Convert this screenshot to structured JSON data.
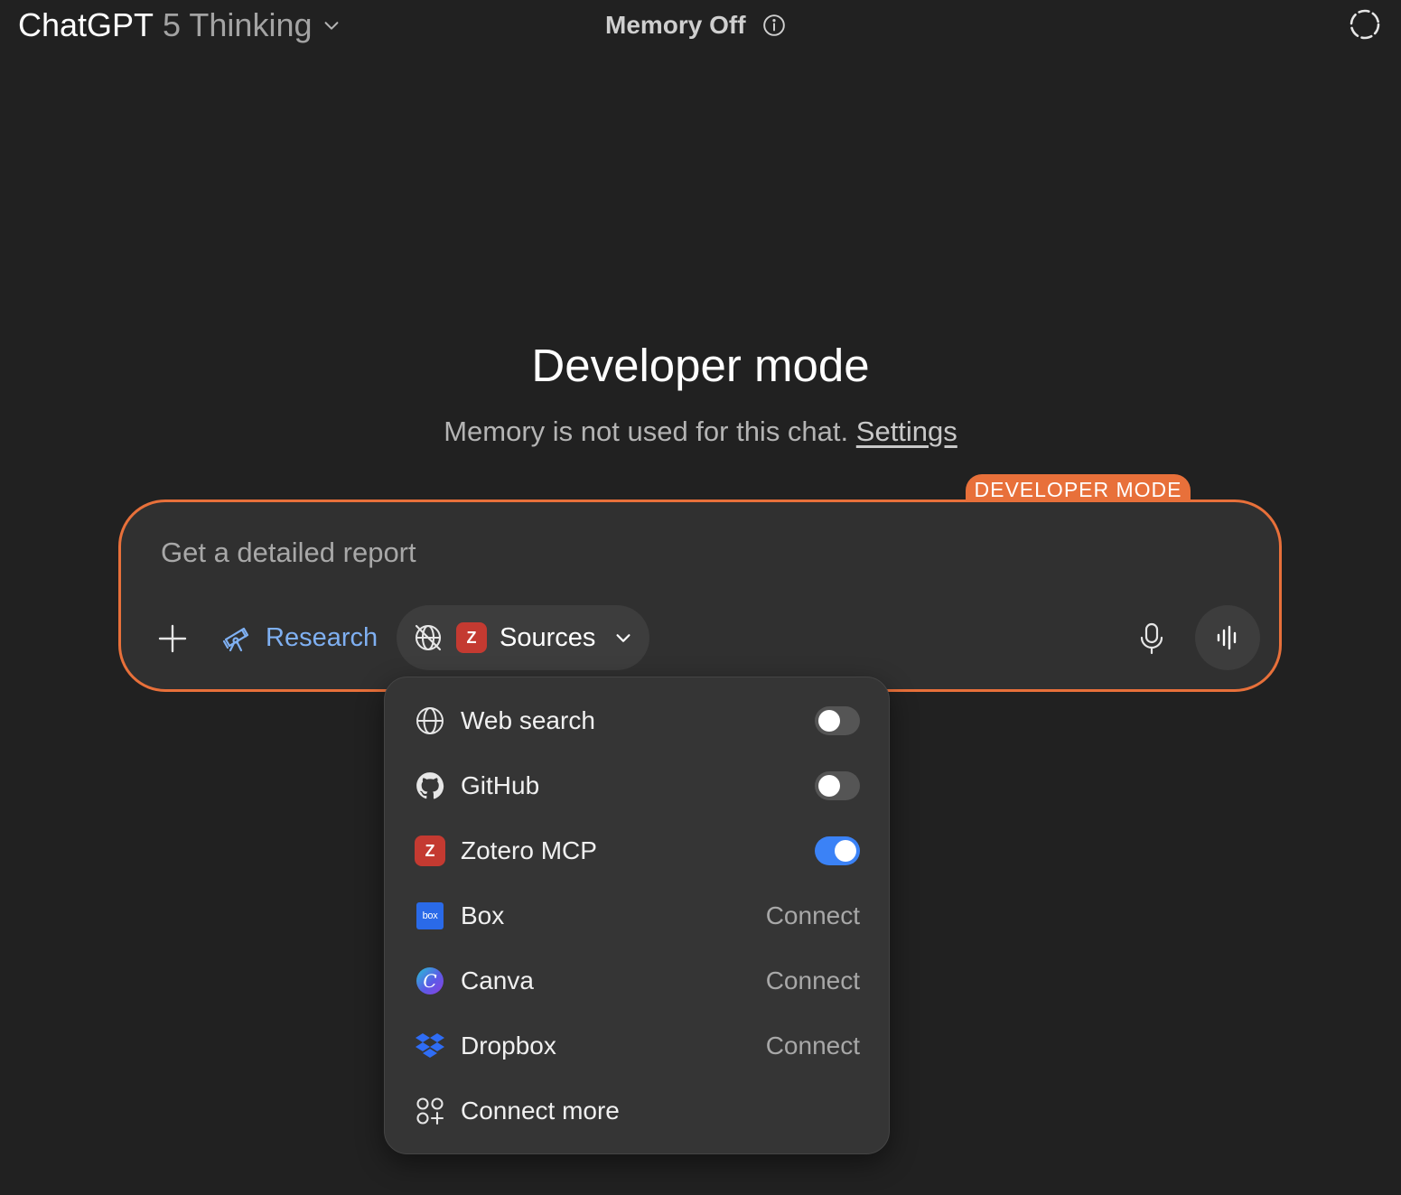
{
  "header": {
    "model_name": "ChatGPT",
    "model_variant": "5 Thinking",
    "memory_status": "Memory Off"
  },
  "hero": {
    "title": "Developer mode",
    "subtitle": "Memory is not used for this chat.",
    "settings_link": "Settings"
  },
  "composer": {
    "badge": "DEVELOPER MODE",
    "placeholder": "Get a detailed report",
    "research_label": "Research",
    "sources_label": "Sources",
    "sources_badge": "Z"
  },
  "sources_menu": {
    "items": [
      {
        "label": "Web search",
        "icon": "globe-icon",
        "toggle": false
      },
      {
        "label": "GitHub",
        "icon": "github-icon",
        "toggle": false
      },
      {
        "label": "Zotero MCP",
        "icon": "zotero-icon",
        "icon_text": "Z",
        "toggle": true
      },
      {
        "label": "Box",
        "icon": "box-icon",
        "icon_text": "box",
        "action": "Connect"
      },
      {
        "label": "Canva",
        "icon": "canva-icon",
        "icon_text": "C",
        "action": "Connect"
      },
      {
        "label": "Dropbox",
        "icon": "dropbox-icon",
        "action": "Connect"
      },
      {
        "label": "Connect more",
        "icon": "apps-plus-icon"
      }
    ]
  },
  "colors": {
    "background": "#212121",
    "accent_orange": "#e8703a",
    "toggle_on": "#3b82f6",
    "research_blue": "#7fb0f2"
  }
}
